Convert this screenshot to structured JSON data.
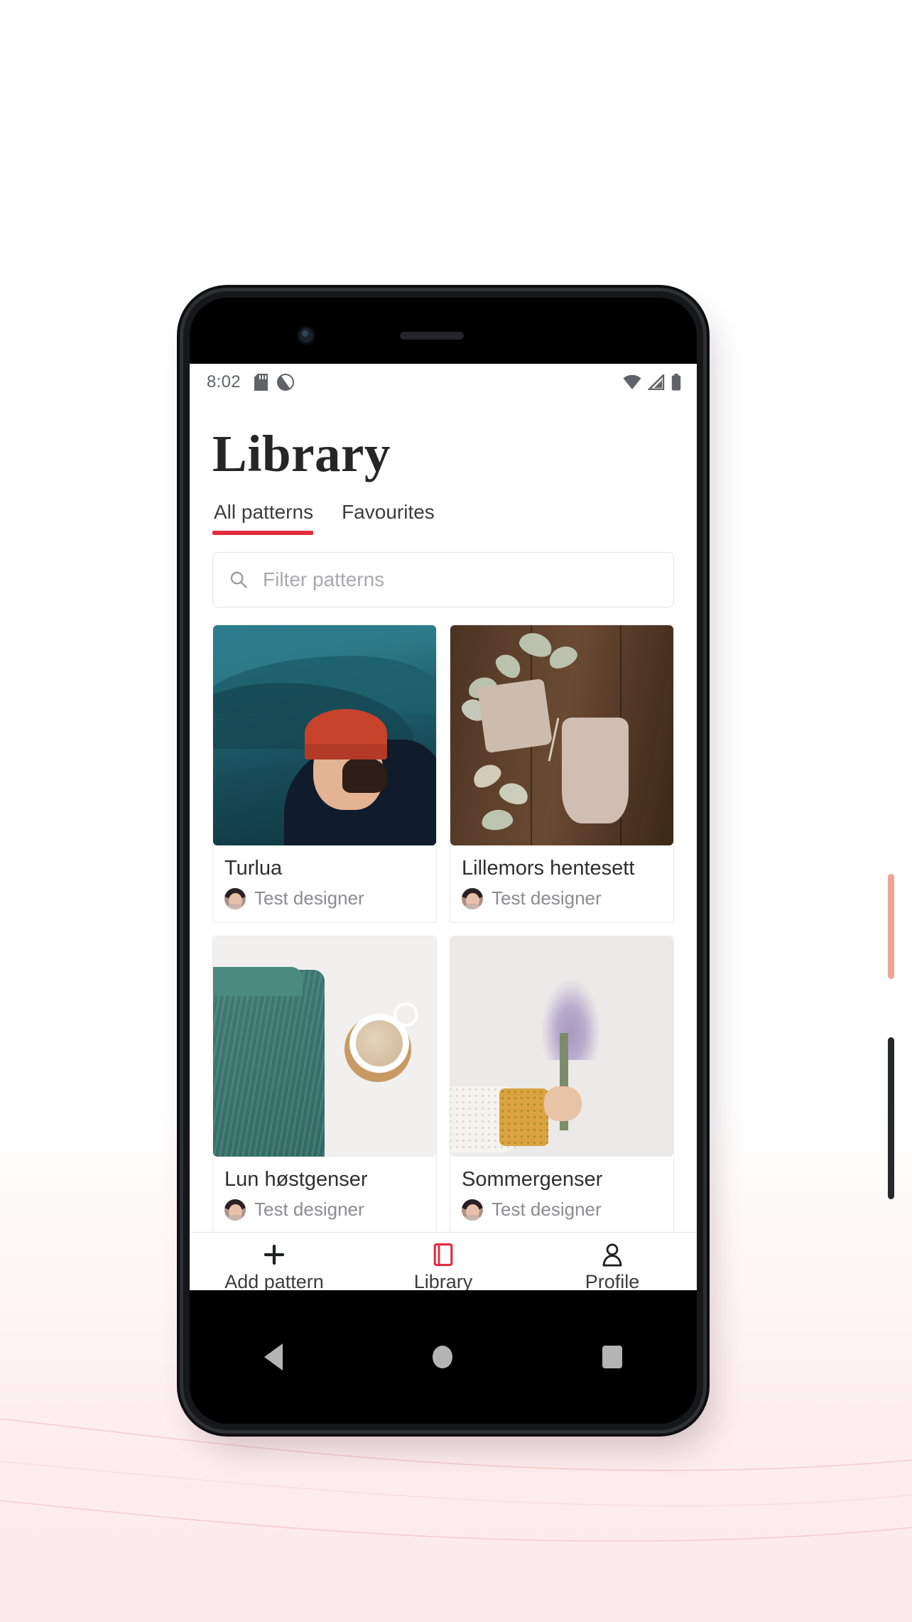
{
  "background": {
    "top_color": "#ffffff",
    "bottom_color": "#fce9ec",
    "line_color": "#f4c6cd"
  },
  "device": {
    "frame_color": "#16171a",
    "power_button_color": "#f0a392",
    "volume_button_color": "#26282c",
    "camera_icon": "front-camera-lens",
    "speaker_icon": "earpiece-speaker"
  },
  "status_bar": {
    "clock": "8:02",
    "left_icons": [
      "sd-card-icon",
      "do-not-disturb-icon"
    ],
    "right_icons": [
      "wifi-icon",
      "cellular-signal-icon",
      "battery-icon"
    ]
  },
  "header": {
    "title": "Library"
  },
  "tabs": [
    {
      "label": "All patterns",
      "active": true
    },
    {
      "label": "Favourites",
      "active": false
    }
  ],
  "search": {
    "icon": "search-icon",
    "placeholder": "Filter patterns",
    "value": ""
  },
  "patterns": [
    {
      "title": "Turlua",
      "author": "Test designer",
      "thumbnail": "man-in-red-beanie-on-teal-mountain-landscape",
      "art_class": "art-turlua"
    },
    {
      "title": "Lillemors hentesett",
      "author": "Test designer",
      "thumbnail": "knitted-baby-bonnet-and-romper-on-dark-wood",
      "art_class": "art-lillemors"
    },
    {
      "title": "Lun høstgenser",
      "author": "Test designer",
      "thumbnail": "folded-teal-knit-sweater-with-cappuccino",
      "art_class": "art-hostgenser"
    },
    {
      "title": "Sommergenser",
      "author": "Test designer",
      "thumbnail": "arm-in-knit-sweater-holding-lavender",
      "art_class": "art-sommergenser"
    }
  ],
  "bottom_nav": [
    {
      "label": "Add pattern",
      "icon": "plus-icon",
      "active": false,
      "color": "#202124"
    },
    {
      "label": "Library",
      "icon": "book-icon",
      "active": true,
      "color": "#e12d3f"
    },
    {
      "label": "Profile",
      "icon": "person-icon",
      "active": false,
      "color": "#202124"
    }
  ],
  "android_nav": {
    "back": "back-triangle-icon",
    "home": "home-circle-icon",
    "recents": "recents-square-icon"
  },
  "colors": {
    "accent_red": "#e12d3f",
    "text_primary": "#262626",
    "text_secondary": "#8c8c90",
    "border": "#e8e8ea"
  }
}
